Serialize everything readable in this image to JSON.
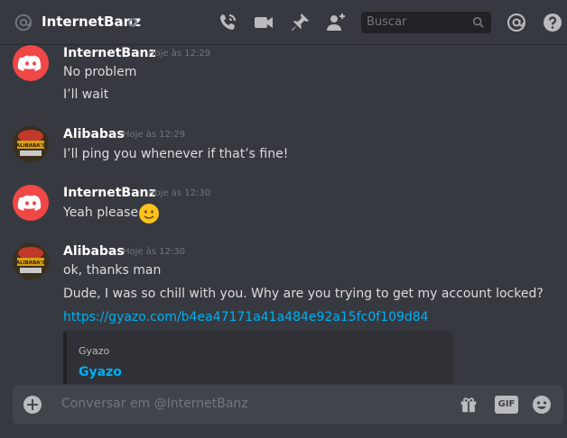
{
  "header": {
    "name": "InternetBanz",
    "search_placeholder": "Buscar"
  },
  "messages": [
    {
      "author": "InternetBanz",
      "timestamp": "Hoje às 12:29",
      "avatar": "discord-logo",
      "lines": [
        "No problem",
        "I’ll wait"
      ]
    },
    {
      "author": "Alibabas",
      "timestamp": "Hoje às 12:29",
      "avatar": "alibabas-logo",
      "avatar_text": "ALIBABA'S",
      "lines": [
        "I’ll ping you whenever if that’s fine!"
      ]
    },
    {
      "author": "InternetBanz",
      "timestamp": "Hoje às 12:30",
      "avatar": "discord-logo",
      "lines": [
        "Yeah please"
      ]
    },
    {
      "author": "Alibabas",
      "timestamp": "Hoje às 12:30",
      "avatar": "alibabas-logo",
      "avatar_text": "ALIBABA'S",
      "lines": [
        "ok, thanks man",
        "Dude, I was so chill with you. Why are you trying to get my account locked?"
      ],
      "link": "https://gyazo.com/b4ea47171a41a484e92a15fc0f109d84",
      "embed": {
        "provider": "Gyazo",
        "title": "Gyazo"
      }
    }
  ],
  "composer": {
    "placeholder": "Conversar em @InternetBanz",
    "gif_label": "GIF"
  },
  "colors": {
    "background": "#36393f",
    "accent_link": "#00b0f4",
    "discord_red": "#f04747"
  }
}
